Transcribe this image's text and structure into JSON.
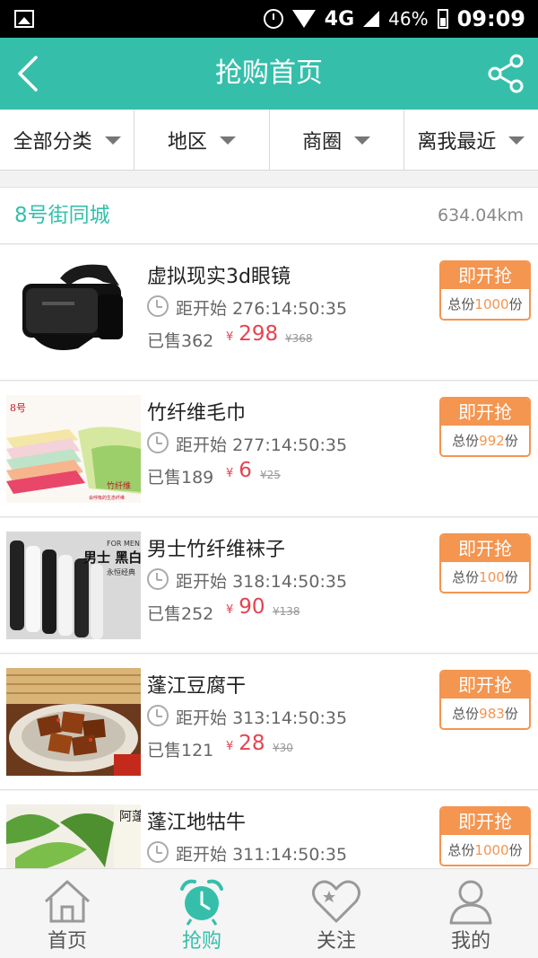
{
  "status_bar": {
    "network": "4G",
    "battery": "46%",
    "time": "09:09"
  },
  "header": {
    "title": "抢购首页"
  },
  "filters": [
    {
      "label": "全部分类"
    },
    {
      "label": "地区"
    },
    {
      "label": "商圈"
    },
    {
      "label": "离我最近"
    }
  ],
  "location": {
    "name": "8号街同城",
    "distance": "634.04km"
  },
  "items": [
    {
      "name": "虚拟现实3d眼镜",
      "countdown_label": "距开始",
      "countdown": "276:14:50:35",
      "sold": "已售362",
      "currency": "¥",
      "price": "298",
      "original_price": "¥368",
      "button": "即开抢",
      "total_prefix": "总份",
      "total_count": "1000",
      "total_suffix": "份"
    },
    {
      "name": "竹纤维毛巾",
      "countdown_label": "距开始",
      "countdown": "277:14:50:35",
      "sold": "已售189",
      "currency": "¥",
      "price": "6",
      "original_price": "¥25",
      "button": "即开抢",
      "total_prefix": "总份",
      "total_count": "992",
      "total_suffix": "份",
      "thumb_brand": "竹纤维",
      "thumb_caption": "会呼吸的生态纤维"
    },
    {
      "name": "男士竹纤维袜子",
      "countdown_label": "距开始",
      "countdown": "318:14:50:35",
      "sold": "已售252",
      "currency": "¥",
      "price": "90",
      "original_price": "¥138",
      "button": "即开抢",
      "total_prefix": "总份",
      "total_count": "100",
      "total_suffix": "份",
      "thumb_top": "FOR MEN",
      "thumb_main": "男士 黑白",
      "thumb_sub": "永恒经典"
    },
    {
      "name": "蓬江豆腐干",
      "countdown_label": "距开始",
      "countdown": "313:14:50:35",
      "sold": "已售121",
      "currency": "¥",
      "price": "28",
      "original_price": "¥30",
      "button": "即开抢",
      "total_prefix": "总份",
      "total_count": "983",
      "total_suffix": "份"
    },
    {
      "name": "蓬江地牯牛",
      "countdown_label": "距开始",
      "countdown": "311:14:50:35",
      "sold": "",
      "currency": "",
      "price": "",
      "original_price": "",
      "button": "即开抢",
      "total_prefix": "总份",
      "total_count": "1000",
      "total_suffix": "份",
      "thumb_text": "阿蓬江地"
    }
  ],
  "tabs": [
    {
      "label": "首页",
      "icon": "home-icon"
    },
    {
      "label": "抢购",
      "icon": "alarm-clock-icon",
      "active": true
    },
    {
      "label": "关注",
      "icon": "heart-icon"
    },
    {
      "label": "我的",
      "icon": "person-icon"
    }
  ],
  "colors": {
    "primary": "#35bfab",
    "accent": "#f49550",
    "price": "#e5434f"
  }
}
